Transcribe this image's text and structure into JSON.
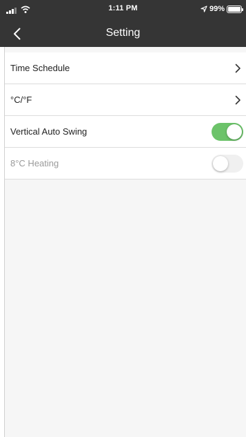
{
  "status_bar": {
    "time": "1:11 PM",
    "battery": "99%",
    "icons": [
      "signal-icon",
      "wifi-icon",
      "location-icon",
      "battery-icon"
    ]
  },
  "nav_bar": {
    "title": "Setting",
    "back_icon": "chevron-left-icon"
  },
  "settings": {
    "items": [
      {
        "label": "Time Schedule",
        "control": "chevron"
      },
      {
        "label": "°C/°F",
        "control": "chevron"
      },
      {
        "label": "Vertical Auto Swing",
        "control": "toggle",
        "on": true
      },
      {
        "label": "8°C Heating",
        "control": "toggle",
        "on": false,
        "disabled": true
      }
    ]
  },
  "colors": {
    "header_bg": "#353535",
    "toggle_on": "#6cc36a",
    "content_bg": "#f6f6f6"
  }
}
